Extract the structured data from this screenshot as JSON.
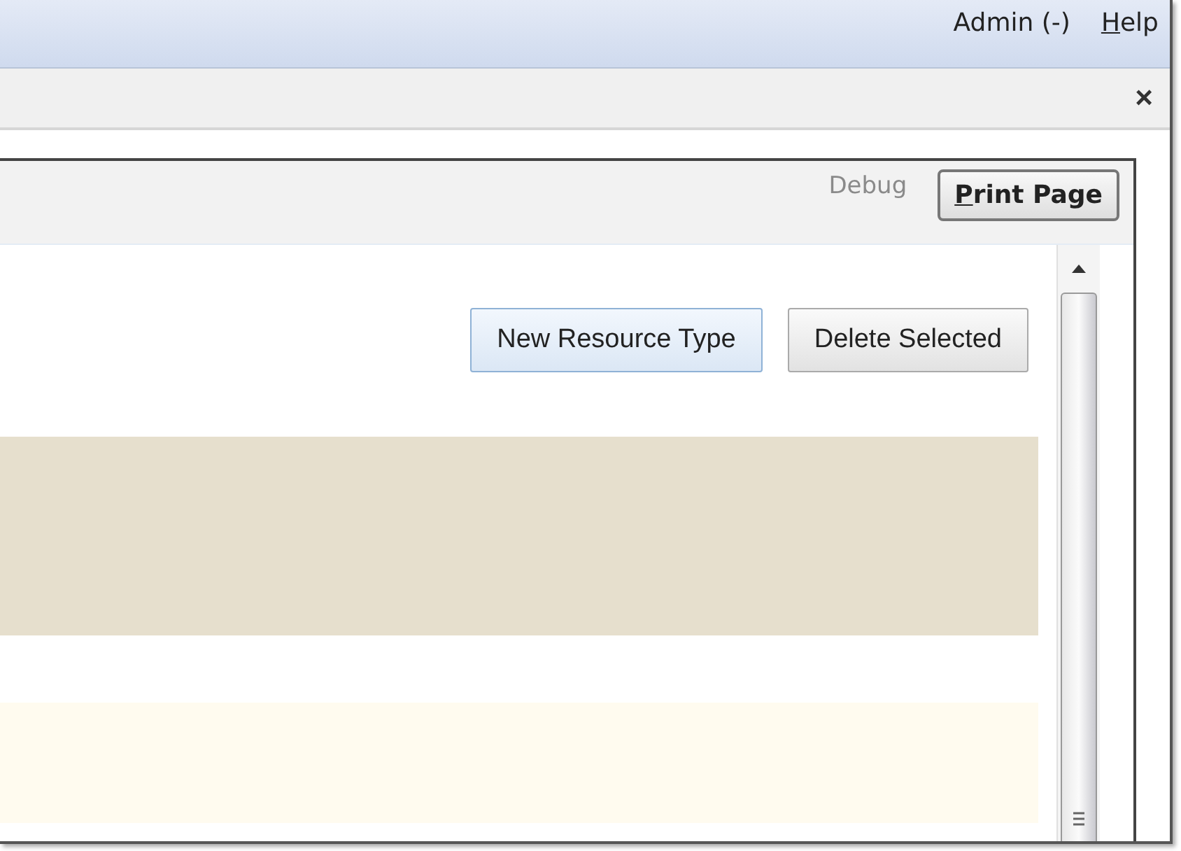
{
  "menu_bar": {
    "items": [
      {
        "label": "Admin (-)"
      },
      {
        "label": "Help"
      }
    ]
  },
  "toolbar": {
    "close": "×"
  },
  "panel": {
    "header": {
      "debug_link": "Debug",
      "print_button": "Print Page"
    },
    "actions": [
      "New Resource Type",
      "Delete Selected"
    ],
    "bands": [
      {
        "kind": "tan"
      },
      {
        "kind": "cream"
      }
    ]
  }
}
